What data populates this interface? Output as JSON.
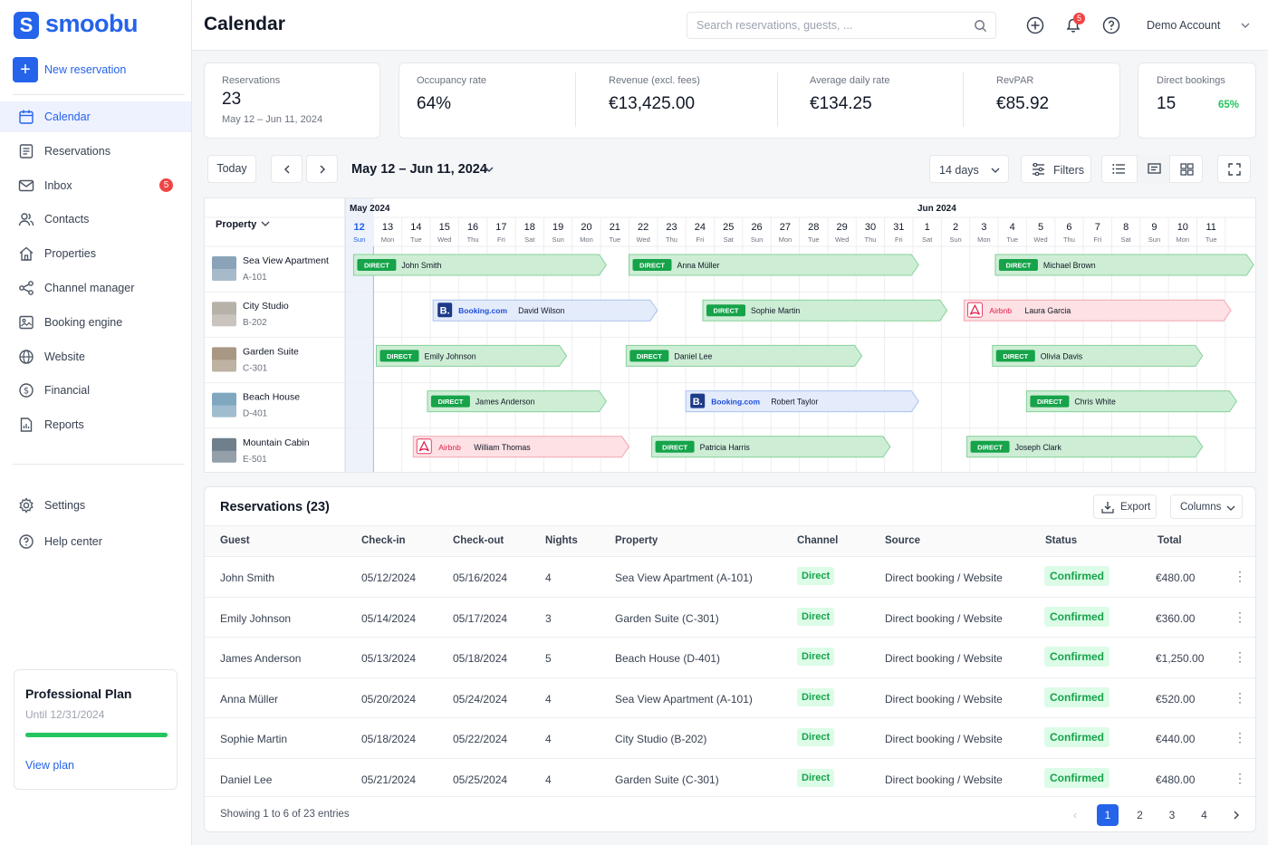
{
  "brand": {
    "name": "smoobu",
    "mark": "S"
  },
  "sidebar": {
    "new_reservation": "New reservation",
    "items": [
      {
        "label": "Calendar",
        "icon": "calendar-icon",
        "active": true
      },
      {
        "label": "Reservations",
        "icon": "list-icon"
      },
      {
        "label": "Inbox",
        "icon": "inbox-icon",
        "badge": "5"
      },
      {
        "label": "Contacts",
        "icon": "users-icon"
      },
      {
        "label": "Properties",
        "icon": "home-icon"
      },
      {
        "label": "Channel manager",
        "icon": "share-icon"
      },
      {
        "label": "Booking engine",
        "icon": "booking-engine-icon"
      },
      {
        "label": "Website",
        "icon": "globe-icon"
      },
      {
        "label": "Financial",
        "icon": "dollar-icon"
      },
      {
        "label": "Reports",
        "icon": "report-icon"
      }
    ],
    "bottom_items": [
      {
        "label": "Settings",
        "icon": "gear-icon"
      },
      {
        "label": "Help center",
        "icon": "help-icon"
      }
    ],
    "plan": {
      "title": "Professional Plan",
      "until": "Until 12/31/2024",
      "progress": 1.0,
      "link": "View plan"
    }
  },
  "header": {
    "title": "Calendar",
    "search_placeholder": "Search reservations, guests, ...",
    "notifications": "5",
    "account": "Demo Account"
  },
  "stats": {
    "reservations": {
      "label": "Reservations",
      "value": "23",
      "sub": "May 12 – Jun 11, 2024"
    },
    "occupancy": {
      "label": "Occupancy rate",
      "value": "64%"
    },
    "revenue": {
      "label": "Revenue (excl. fees)",
      "value": "€13,425.00"
    },
    "adr": {
      "label": "Average daily rate",
      "value": "€134.25"
    },
    "revpar": {
      "label": "RevPAR",
      "value": "€85.92"
    },
    "direct": {
      "label": "Direct bookings",
      "value": "15",
      "pct": "65%"
    }
  },
  "toolbar": {
    "today": "Today",
    "range": "May 12 – Jun 11, 2024",
    "days": "14 days",
    "filters": "Filters"
  },
  "calendar": {
    "property_header": "Property",
    "months": [
      {
        "label": "May 2024",
        "start_index": 0
      },
      {
        "label": "Jun 2024",
        "start_index": 20
      }
    ],
    "days": [
      [
        "12",
        "Sun"
      ],
      [
        "13",
        "Mon"
      ],
      [
        "14",
        "Tue"
      ],
      [
        "15",
        "Wed"
      ],
      [
        "16",
        "Thu"
      ],
      [
        "17",
        "Fri"
      ],
      [
        "18",
        "Sat"
      ],
      [
        "19",
        "Sun"
      ],
      [
        "20",
        "Mon"
      ],
      [
        "21",
        "Tue"
      ],
      [
        "22",
        "Wed"
      ],
      [
        "23",
        "Thu"
      ],
      [
        "24",
        "Fri"
      ],
      [
        "25",
        "Sat"
      ],
      [
        "26",
        "Sun"
      ],
      [
        "27",
        "Mon"
      ],
      [
        "28",
        "Tue"
      ],
      [
        "29",
        "Wed"
      ],
      [
        "30",
        "Thu"
      ],
      [
        "31",
        "Fri"
      ],
      [
        "1",
        "Sat"
      ],
      [
        "2",
        "Sun"
      ],
      [
        "3",
        "Mon"
      ],
      [
        "4",
        "Tue"
      ],
      [
        "5",
        "Wed"
      ],
      [
        "6",
        "Thu"
      ],
      [
        "7",
        "Fri"
      ],
      [
        "8",
        "Sat"
      ],
      [
        "9",
        "Sun"
      ],
      [
        "10",
        "Mon"
      ],
      [
        "11",
        "Tue"
      ]
    ],
    "properties": [
      {
        "name": "Sea View Apartment",
        "code": "A-101",
        "thumb": "#8aa3b8"
      },
      {
        "name": "City Studio",
        "code": "B-202",
        "thumb": "#b7b2a8"
      },
      {
        "name": "Garden Suite",
        "code": "C-301",
        "thumb": "#a89883"
      },
      {
        "name": "Beach House",
        "code": "D-401",
        "thumb": "#7fa7bf"
      },
      {
        "name": "Mountain Cabin",
        "code": "E-501",
        "thumb": "#6f7f8c"
      }
    ],
    "bookings": [
      {
        "row": 0,
        "start": 0.3,
        "end": 9.2,
        "channel": "direct",
        "guest": "John Smith"
      },
      {
        "row": 0,
        "start": 10.0,
        "end": 20.2,
        "channel": "direct",
        "guest": "Anna Müller"
      },
      {
        "row": 0,
        "start": 22.9,
        "end": 32.0,
        "channel": "direct",
        "guest": "Michael Brown"
      },
      {
        "row": 1,
        "start": 3.1,
        "end": 11.0,
        "channel": "booking",
        "guest": "David Wilson"
      },
      {
        "row": 1,
        "start": 12.6,
        "end": 21.2,
        "channel": "direct",
        "guest": "Sophie Martin"
      },
      {
        "row": 1,
        "start": 21.8,
        "end": 31.2,
        "channel": "airbnb",
        "guest": "Laura Garcia"
      },
      {
        "row": 2,
        "start": 1.1,
        "end": 7.8,
        "channel": "direct",
        "guest": "Emily Johnson"
      },
      {
        "row": 2,
        "start": 9.9,
        "end": 18.2,
        "channel": "direct",
        "guest": "Daniel Lee"
      },
      {
        "row": 2,
        "start": 22.8,
        "end": 30.2,
        "channel": "direct",
        "guest": "Olivia Davis"
      },
      {
        "row": 3,
        "start": 2.9,
        "end": 9.2,
        "channel": "direct",
        "guest": "James Anderson"
      },
      {
        "row": 3,
        "start": 12.0,
        "end": 20.2,
        "channel": "booking",
        "guest": "Robert Taylor"
      },
      {
        "row": 3,
        "start": 24.0,
        "end": 31.4,
        "channel": "direct",
        "guest": "Chris White"
      },
      {
        "row": 4,
        "start": 2.4,
        "end": 10.0,
        "channel": "airbnb",
        "guest": "William Thomas"
      },
      {
        "row": 4,
        "start": 10.8,
        "end": 19.2,
        "channel": "direct",
        "guest": "Patricia Harris"
      },
      {
        "row": 4,
        "start": 21.9,
        "end": 30.2,
        "channel": "direct",
        "guest": "Joseph Clark"
      }
    ],
    "channel_labels": {
      "direct": "DIRECT",
      "booking": "Booking.com",
      "airbnb": "Airbnb"
    },
    "colors": {
      "direct_bg": "#cdeed5",
      "direct_border": "#86d19a",
      "direct_tag": "#16a34a",
      "booking_bg": "#e4ecfb",
      "booking_border": "#a9c1ef",
      "booking_tag": "#1e3a8a",
      "airbnb_bg": "#fde1e4",
      "airbnb_border": "#f4a6b0",
      "airbnb_tag": "#e11d48"
    }
  },
  "table": {
    "title": "Reservations (23)",
    "export": "Export",
    "columns_btn": "Columns",
    "headers": [
      "Guest",
      "Check-in",
      "Check-out",
      "Nights",
      "Property",
      "Channel",
      "Source",
      "Status",
      "Total"
    ],
    "rows": [
      [
        "John Smith",
        "05/12/2024",
        "05/16/2024",
        "4",
        "Sea View Apartment (A-101)",
        "Direct",
        "Direct booking / Website",
        "Confirmed",
        "€480.00"
      ],
      [
        "Emily Johnson",
        "05/14/2024",
        "05/17/2024",
        "3",
        "Garden Suite (C-301)",
        "Direct",
        "Direct booking / Website",
        "Confirmed",
        "€360.00"
      ],
      [
        "James Anderson",
        "05/13/2024",
        "05/18/2024",
        "5",
        "Beach House (D-401)",
        "Direct",
        "Direct booking / Website",
        "Confirmed",
        "€1,250.00"
      ],
      [
        "Anna Müller",
        "05/20/2024",
        "05/24/2024",
        "4",
        "Sea View Apartment (A-101)",
        "Direct",
        "Direct booking / Website",
        "Confirmed",
        "€520.00"
      ],
      [
        "Sophie Martin",
        "05/18/2024",
        "05/22/2024",
        "4",
        "City Studio (B-202)",
        "Direct",
        "Direct booking / Website",
        "Confirmed",
        "€440.00"
      ],
      [
        "Daniel Lee",
        "05/21/2024",
        "05/25/2024",
        "4",
        "Garden Suite (C-301)",
        "Direct",
        "Direct booking / Website",
        "Confirmed",
        "€480.00"
      ]
    ],
    "footer": "Showing 1 to 6 of 23 entries",
    "pages": [
      "1",
      "2",
      "3",
      "4"
    ],
    "current_page": "1"
  }
}
